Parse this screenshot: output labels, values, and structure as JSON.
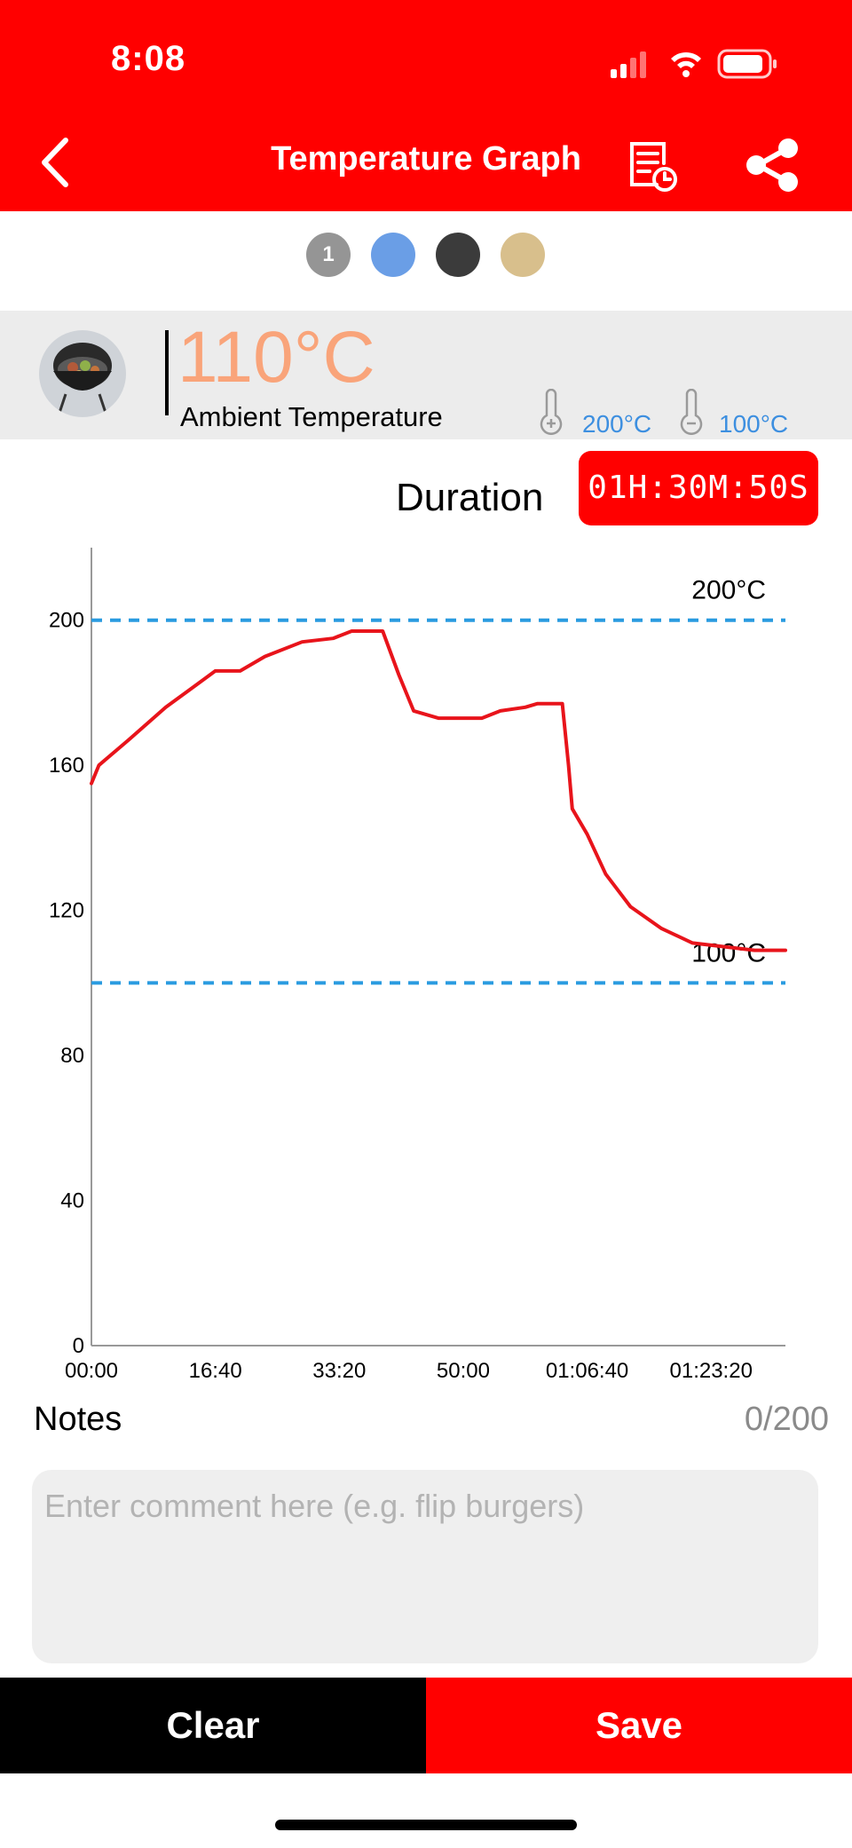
{
  "status_bar": {
    "time": "8:08",
    "icons": [
      "cellular-signal-icon",
      "wifi-icon",
      "battery-icon"
    ]
  },
  "header": {
    "title": "Temperature Graph",
    "icons": [
      "back-chevron-icon",
      "log-report-icon",
      "share-icon"
    ]
  },
  "probe_selector": {
    "dots": [
      {
        "label": "1",
        "color": "#959595"
      },
      {
        "label": "",
        "color": "#6a9ee6"
      },
      {
        "label": "",
        "color": "#3b3b3b"
      },
      {
        "label": "",
        "color": "#d8bf8c"
      }
    ]
  },
  "probe": {
    "temperature": "110°C",
    "label": "Ambient Temperature",
    "high_target": "200°C",
    "low_target": "100°C",
    "temp_color": "#f9a47a",
    "target_color": "#3d8fe0"
  },
  "duration": {
    "label": "Duration",
    "value": "01H:30M:50S"
  },
  "chart_data": {
    "type": "line",
    "title": "",
    "xlabel": "",
    "ylabel": "",
    "ylim": [
      0,
      220
    ],
    "xlim": [
      0,
      5600
    ],
    "y_ticks": [
      "0",
      "40",
      "80",
      "120",
      "160",
      "200"
    ],
    "x_ticks": [
      "00:00",
      "16:40",
      "33:20",
      "50:00",
      "01:06:40",
      "01:23:20"
    ],
    "grid": false,
    "line_color": "#e8141b",
    "threshold_color": "#2a9be0",
    "thresholds": [
      {
        "value": 200,
        "label": "200°C"
      },
      {
        "value": 100,
        "label": "100°C"
      }
    ],
    "series": [
      {
        "points": [
          [
            0,
            155
          ],
          [
            60,
            160
          ],
          [
            300,
            167
          ],
          [
            600,
            176
          ],
          [
            800,
            181
          ],
          [
            1000,
            186
          ],
          [
            1200,
            186
          ],
          [
            1400,
            190
          ],
          [
            1700,
            194
          ],
          [
            1950,
            195
          ],
          [
            2100,
            197
          ],
          [
            2350,
            197
          ],
          [
            2480,
            185
          ],
          [
            2600,
            175
          ],
          [
            2800,
            173
          ],
          [
            3000,
            173
          ],
          [
            3150,
            173
          ],
          [
            3300,
            175
          ],
          [
            3500,
            176
          ],
          [
            3600,
            177
          ],
          [
            3800,
            177
          ],
          [
            3850,
            160
          ],
          [
            3880,
            148
          ],
          [
            4000,
            141
          ],
          [
            4150,
            130
          ],
          [
            4350,
            121
          ],
          [
            4600,
            115
          ],
          [
            4850,
            111
          ],
          [
            5100,
            110
          ],
          [
            5350,
            109
          ],
          [
            5500,
            109
          ],
          [
            5600,
            109
          ]
        ]
      }
    ]
  },
  "notes": {
    "label": "Notes",
    "counter": "0/200",
    "placeholder": "Enter comment here (e.g. flip burgers)"
  },
  "actions": {
    "clear_label": "Clear",
    "save_label": "Save"
  }
}
